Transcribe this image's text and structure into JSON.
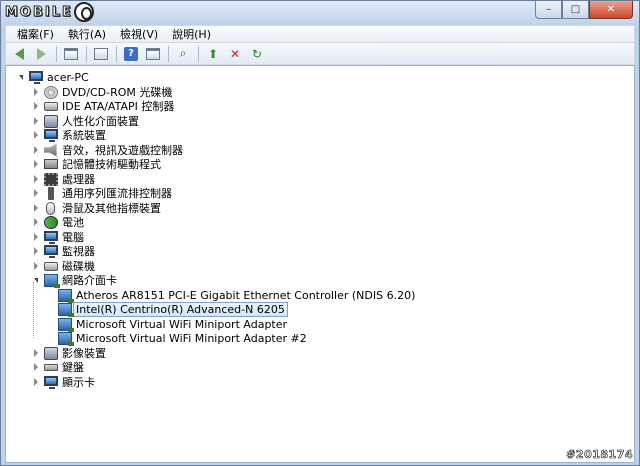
{
  "logo": {
    "text": "MOBILE"
  },
  "window": {
    "buttons": [
      "–",
      "□",
      "✕"
    ]
  },
  "menu": [
    "檔案(F)",
    "執行(A)",
    "檢視(V)",
    "說明(H)"
  ],
  "toolbar": {
    "icons": [
      "back-arrow-icon",
      "forward-arrow-icon",
      "properties-icon",
      "show-hide-icon",
      "help-icon",
      "window-icon",
      "scan-hardware-icon",
      "update-driver-icon",
      "uninstall-icon",
      "enable-device-icon"
    ]
  },
  "tree": {
    "root": "acer-PC",
    "categories": [
      {
        "label": "DVD/CD-ROM 光碟機",
        "icon": "disc-drive-icon"
      },
      {
        "label": "IDE ATA/ATAPI 控制器",
        "icon": "ide-controller-icon"
      },
      {
        "label": "人性化介面裝置",
        "icon": "hid-icon"
      },
      {
        "label": "系統裝置",
        "icon": "system-device-icon"
      },
      {
        "label": "音效，視訊及遊戲控制器",
        "icon": "speaker-icon"
      },
      {
        "label": "記憶體技術驅動程式",
        "icon": "memory-icon"
      },
      {
        "label": "處理器",
        "icon": "processor-icon"
      },
      {
        "label": "通用序列匯流排控制器",
        "icon": "usb-icon"
      },
      {
        "label": "滑鼠及其他指標裝置",
        "icon": "mouse-icon"
      },
      {
        "label": "電池",
        "icon": "battery-icon"
      },
      {
        "label": "電腦",
        "icon": "computer-icon"
      },
      {
        "label": "監視器",
        "icon": "monitor-icon"
      },
      {
        "label": "磁碟機",
        "icon": "disk-drive-icon"
      },
      {
        "label": "網路介面卡",
        "icon": "network-adapter-icon"
      }
    ],
    "network_children": [
      "Atheros AR8151 PCI-E Gigabit Ethernet Controller (NDIS 6.20)",
      "Intel(R) Centrino(R) Advanced-N 6205",
      "Microsoft Virtual WiFi Miniport Adapter",
      "Microsoft Virtual WiFi Miniport Adapter #2"
    ],
    "selected": "Intel(R) Centrino(R) Advanced-N 6205",
    "tail_categories": [
      {
        "label": "影像裝置",
        "icon": "imaging-device-icon"
      },
      {
        "label": "鍵盤",
        "icon": "keyboard-icon"
      },
      {
        "label": "顯示卡",
        "icon": "display-adapter-icon"
      }
    ]
  },
  "watermark": "#2018174"
}
